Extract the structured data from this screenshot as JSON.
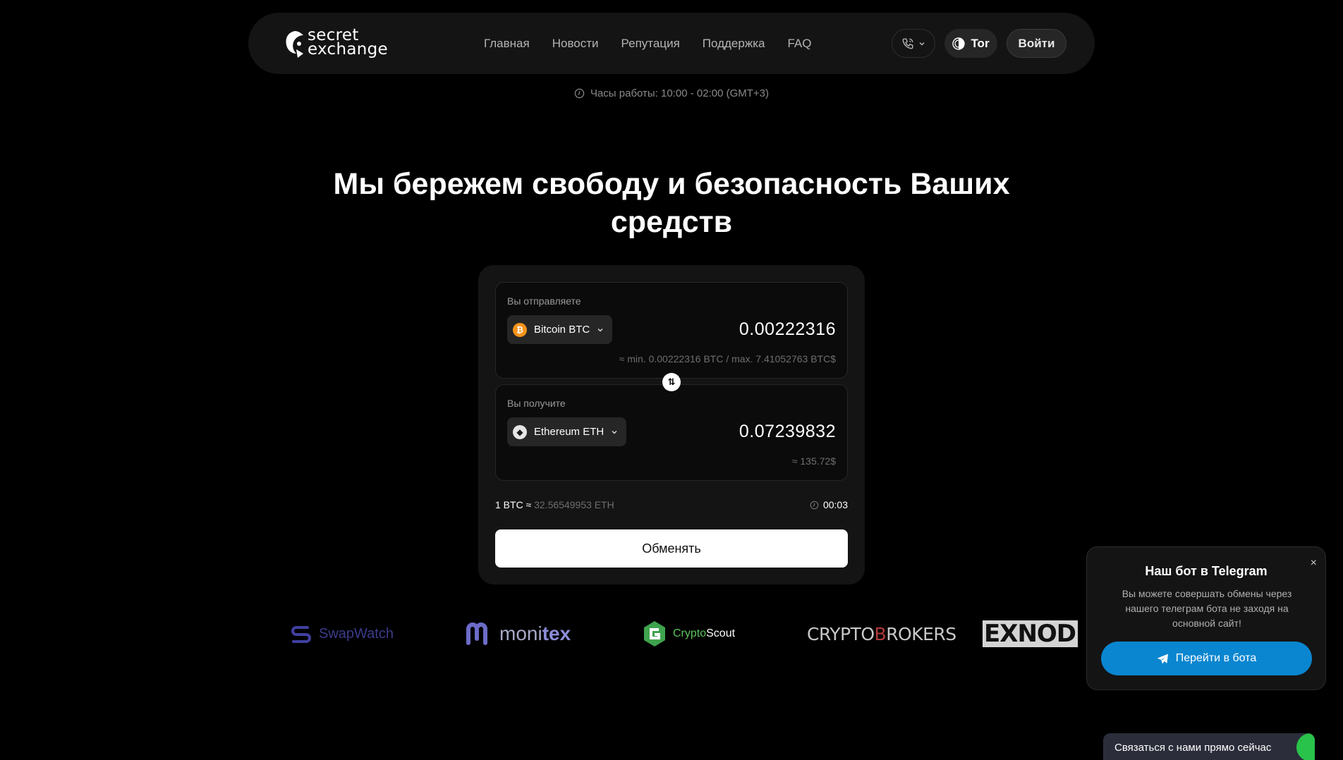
{
  "header": {
    "logo_line1": "secret",
    "logo_line2": "exchange",
    "nav": [
      "Главная",
      "Новости",
      "Репутация",
      "Поддержка",
      "FAQ"
    ],
    "tor_label": "Tor",
    "login_label": "Войти"
  },
  "hours": "Часы работы: 10:00 - 02:00 (GMT+3)",
  "hero_title": "Мы бережем свободу и безопасность Ваших средств",
  "exchange": {
    "send_label": "Вы отправляете",
    "send_coin": "Bitcoin BTC",
    "send_amount": "0.00222316",
    "send_limits": "≈ min. 0.00222316 BTC / max. 7.41052763 BTC$",
    "receive_label": "Вы получите",
    "receive_coin": "Ethereum ETH",
    "receive_amount": "0.07239832",
    "receive_usd": "≈ 135.72$",
    "rate_base": "1 BTC ≈",
    "rate_value": "32.56549953 ETH",
    "timer": "00:03",
    "exchange_button": "Обменять"
  },
  "partners": {
    "swapwatch": "SwapWatch",
    "monitex_a": "moni",
    "monitex_b": "tex",
    "cryptoscout_a": "Crypto",
    "cryptoscout_b": "Scout",
    "cryptobrokers_a": "CRYPTO",
    "cryptobrokers_b": "B",
    "cryptobrokers_c": "ROKERS",
    "exnode": "EXNODE"
  },
  "telegram_popup": {
    "title": "Наш бот в Telegram",
    "text": "Вы можете совершать обмены через нашего телеграм бота не заходя на основной сайт!",
    "button": "Перейти в бота",
    "close": "×"
  },
  "contact_label": "Связаться с нами прямо сейчас",
  "colors": {
    "background": "#000000",
    "panel": "#141414",
    "btc": "#f7931a",
    "telegram": "#0a86d0",
    "contact_dot": "#29c24a"
  }
}
